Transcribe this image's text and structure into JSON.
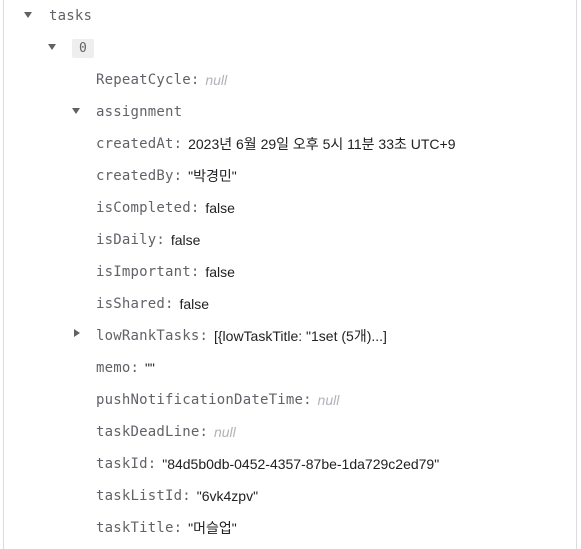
{
  "tree": {
    "root_key": "tasks",
    "item_index": "0",
    "repeat_cycle": {
      "key": "RepeatCycle",
      "value": "null"
    },
    "assignment_key": "assignment",
    "fields": {
      "createdAt": {
        "key": "createdAt",
        "value": "2023년 6월 29일 오후 5시 11분 33초 UTC+9"
      },
      "createdBy": {
        "key": "createdBy",
        "value": "\"박경민\""
      },
      "isCompleted": {
        "key": "isCompleted",
        "value": "false"
      },
      "isDaily": {
        "key": "isDaily",
        "value": "false"
      },
      "isImportant": {
        "key": "isImportant",
        "value": "false"
      },
      "isShared": {
        "key": "isShared",
        "value": "false"
      },
      "lowRankTasks": {
        "key": "lowRankTasks",
        "value": "[{lowTaskTitle: \"1set (5개)...]"
      },
      "memo": {
        "key": "memo",
        "value": "\"\""
      },
      "pushNotificationDateTime": {
        "key": "pushNotificationDateTime",
        "value": "null"
      },
      "taskDeadLine": {
        "key": "taskDeadLine",
        "value": "null"
      },
      "taskId": {
        "key": "taskId",
        "value": "\"84d5b0db-0452-4357-87be-1da729c2ed79\""
      },
      "taskListId": {
        "key": "taskListId",
        "value": "\"6vk4zpv\""
      },
      "taskTitle": {
        "key": "taskTitle",
        "value": "\"머슬업\""
      }
    },
    "colon": ":"
  },
  "colors": {
    "key_text": "#5f6368",
    "value_text": "#202124",
    "null_text": "#b0b3b8",
    "chip_bg": "#eeeeee",
    "rule": "#dcdcdc"
  },
  "icons": {
    "expanded": "caret-down-icon",
    "collapsed": "caret-right-icon"
  }
}
